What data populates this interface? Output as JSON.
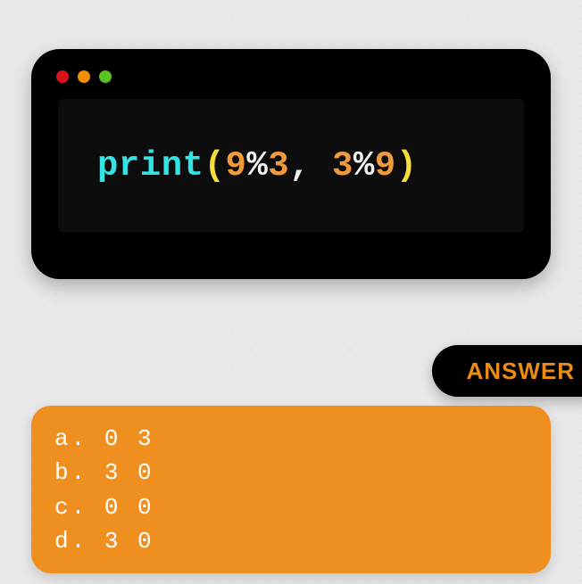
{
  "window": {
    "controls": [
      "red",
      "orange",
      "green"
    ]
  },
  "code": {
    "tokens": [
      {
        "text": "print",
        "cls": "tok-cyan"
      },
      {
        "text": "(",
        "cls": "tok-yellow"
      },
      {
        "text": "9",
        "cls": "tok-orange"
      },
      {
        "text": "%",
        "cls": "tok-white"
      },
      {
        "text": "3",
        "cls": "tok-orange"
      },
      {
        "text": ", ",
        "cls": "tok-white"
      },
      {
        "text": "3",
        "cls": "tok-orange"
      },
      {
        "text": "%",
        "cls": "tok-white"
      },
      {
        "text": "9",
        "cls": "tok-orange"
      },
      {
        "text": ")",
        "cls": "tok-yellow"
      }
    ]
  },
  "answer_label": "ANSWER",
  "options": [
    {
      "letter": "a",
      "text": "0 3"
    },
    {
      "letter": "b",
      "text": "3 0"
    },
    {
      "letter": "c",
      "text": "0 0"
    },
    {
      "letter": "d",
      "text": "3 0"
    }
  ]
}
